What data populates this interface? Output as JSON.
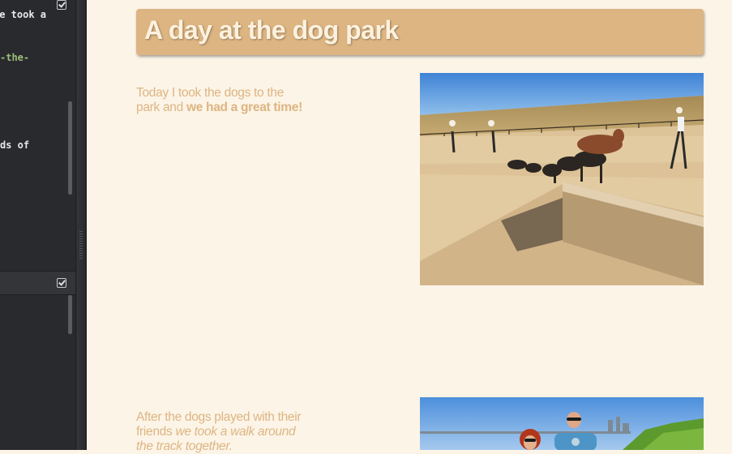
{
  "editor": {
    "lines": [
      {
        "text": "we took a",
        "style": "cut"
      },
      {
        "text": "-the-",
        "style": "green"
      },
      {
        "text": "ds of",
        "style": "plain"
      }
    ]
  },
  "preview": {
    "title": "A day at the dog park",
    "sections": [
      {
        "text_1": "Today I took the dogs to the park and ",
        "bold": "we had a great time!",
        "photo": "dogs-at-park-photo"
      },
      {
        "text_1": "After the dogs played with their friends ",
        "italic": "we took a walk around the track together.",
        "photo": "couple-walking-photo"
      }
    ]
  },
  "colors": {
    "page_bg": "#fcf4e7",
    "accent": "#ddb582",
    "title_text": "#fdf1de",
    "editor_bg": "#292a2e"
  }
}
